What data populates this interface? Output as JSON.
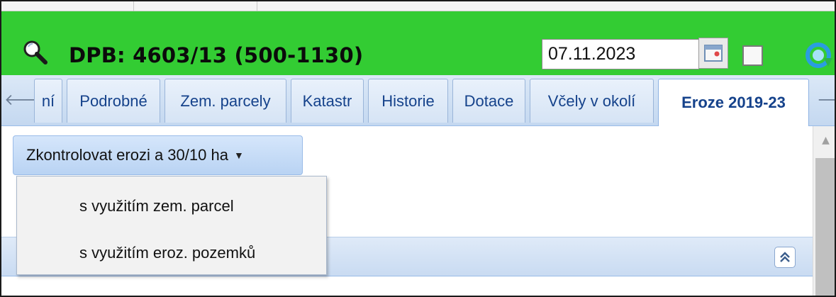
{
  "header": {
    "title": "DPB: 4603/13 (500-1130)",
    "date_value": "07.11.2023",
    "checkbox_checked": false
  },
  "tabs": [
    {
      "label": "ní",
      "active": false
    },
    {
      "label": "Podrobné",
      "active": false
    },
    {
      "label": "Zem. parcely",
      "active": false
    },
    {
      "label": "Katastr",
      "active": false
    },
    {
      "label": "Historie",
      "active": false
    },
    {
      "label": "Dotace",
      "active": false
    },
    {
      "label": "Včely v okolí",
      "active": false
    },
    {
      "label": "Eroze 2019-23",
      "active": true
    }
  ],
  "toolbar": {
    "split_button_label": "Zkontrolovat erozi a 30/10 ha"
  },
  "menu": {
    "items": [
      {
        "label": "s využitím zem. parcel"
      },
      {
        "label": "s využitím eroz. pozemků"
      }
    ]
  },
  "colors": {
    "header_bg": "#33cc33",
    "tab_text": "#15428b",
    "button_bg": "#c6dcf5"
  },
  "icons": {
    "search": "search-icon",
    "calendar": "calendar-icon",
    "refresh": "refresh-icon",
    "tab_prev": "arrow-left-icon",
    "tab_next": "arrow-right-icon",
    "collapse": "double-chevron-up-icon",
    "dropdown": "caret-down-icon"
  }
}
